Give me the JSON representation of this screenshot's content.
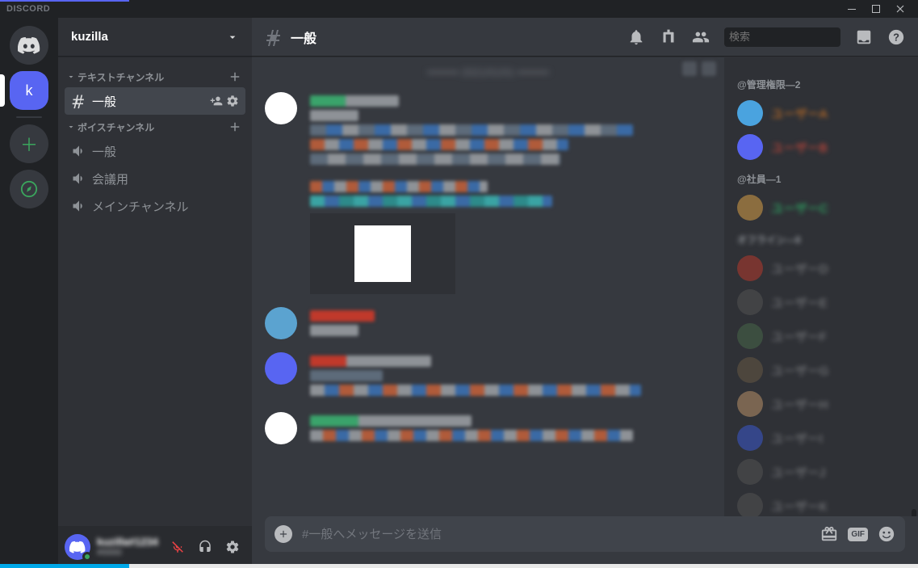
{
  "app_name": "DISCORD",
  "server": {
    "name": "kuzilla",
    "selected_initial": "k"
  },
  "channel_sidebar": {
    "cat_text": "テキストチャンネル",
    "cat_voice": "ボイスチャンネル",
    "text_channels": [
      {
        "name": "一般",
        "selected": true
      }
    ],
    "voice_channels": [
      {
        "name": "一般"
      },
      {
        "name": "会議用"
      },
      {
        "name": "メインチャンネル"
      }
    ]
  },
  "user_panel": {
    "username_blur": "kuzilla#1234",
    "tag_blur": "#0000"
  },
  "header": {
    "channel_name": "一般",
    "search_placeholder": "検索"
  },
  "composer": {
    "placeholder": "#一般へメッセージを送信",
    "gif_label": "GIF"
  },
  "members": {
    "role_admin": "@管理権限—2",
    "role_staff": "@社員—1",
    "admins": [
      {
        "name_blur": "ユーザーA",
        "color": "#e67e22",
        "avatar": "#4aa3df"
      },
      {
        "name_blur": "ユーザーB",
        "color": "#e74c3c",
        "avatar": "#5865f2"
      }
    ],
    "staff": [
      {
        "name_blur": "ユーザーC",
        "color": "#2ecc71",
        "avatar": "#8b6d3f"
      }
    ],
    "offline": [
      {
        "name_blur": "ユーザーD",
        "avatar": "#c0392b"
      },
      {
        "name_blur": "ユーザーE",
        "avatar": "#555"
      },
      {
        "name_blur": "ユーザーF",
        "avatar": "#4a6b4a"
      },
      {
        "name_blur": "ユーザーG",
        "avatar": "#6b5b45"
      },
      {
        "name_blur": "ユーザーH",
        "avatar": "#c49a6c"
      },
      {
        "name_blur": "ユーザーI",
        "avatar": "#3b5bdb"
      },
      {
        "name_blur": "ユーザーJ",
        "avatar": "#555"
      },
      {
        "name_blur": "ユーザーK",
        "avatar": "#555"
      }
    ]
  }
}
